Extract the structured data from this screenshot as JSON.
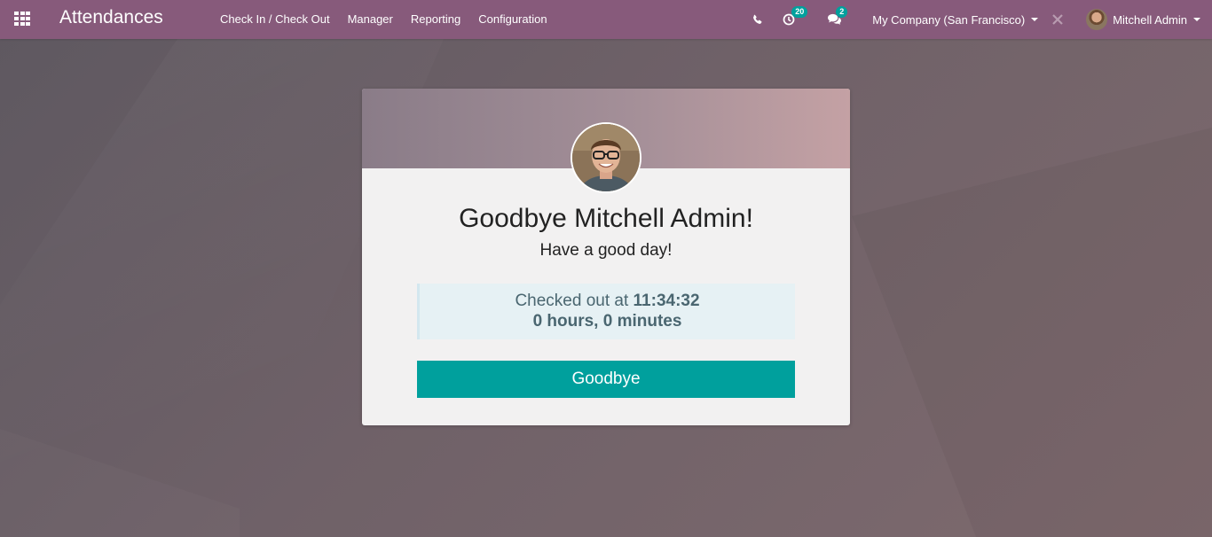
{
  "navbar": {
    "app_title": "Attendances",
    "menu": [
      "Check In / Check Out",
      "Manager",
      "Reporting",
      "Configuration"
    ],
    "activity_count": "20",
    "messages_count": "2",
    "company": "My Company (San Francisco)",
    "user_name": "Mitchell Admin",
    "icons": {
      "apps": "apps-grid-icon",
      "phone": "phone-icon",
      "activity": "clock-icon",
      "messages": "comments-icon",
      "close": "close-icon"
    },
    "color": "#875a7b"
  },
  "card": {
    "greeting": "Goodbye Mitchell Admin!",
    "subgreeting": "Have a good day!",
    "checked_out_label": "Checked out at",
    "checked_out_time": "11:34:32",
    "worked_duration": "0 hours, 0 minutes",
    "button_label": "Goodbye",
    "button_color": "#00a09d"
  }
}
